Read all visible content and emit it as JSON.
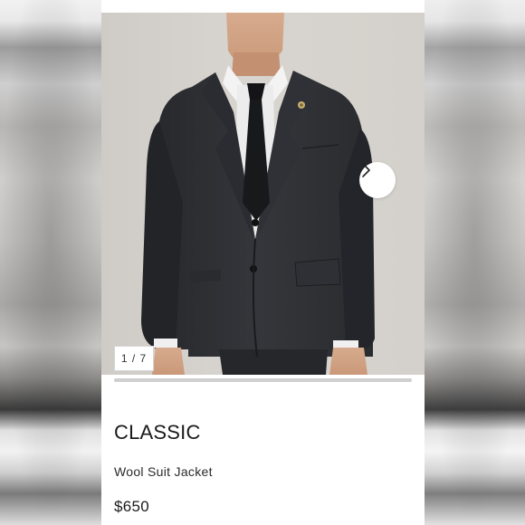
{
  "product": {
    "brand": "CLASSIC",
    "name": "Wool Suit Jacket",
    "price": "$650"
  },
  "gallery": {
    "counter": "1 / 7",
    "current_index": 1,
    "total_images": 7,
    "next_icon": "chevron-right-icon",
    "progress_fraction": 1.0
  },
  "colors": {
    "card_background": "#ffffff",
    "jacket": "#2e2f33",
    "text": "#1a1a1a"
  }
}
